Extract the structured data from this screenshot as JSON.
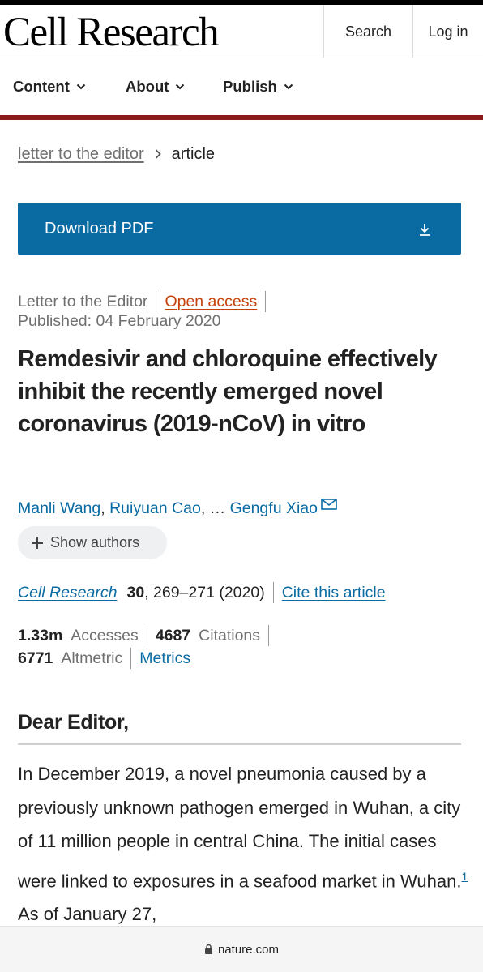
{
  "header": {
    "logo": "Cell Research",
    "search_label": "Search",
    "login_label": "Log in"
  },
  "nav": {
    "items": [
      {
        "label": "Content"
      },
      {
        "label": "About"
      },
      {
        "label": "Publish"
      }
    ]
  },
  "breadcrumb": {
    "parent": "letter to the editor",
    "current": "article"
  },
  "download": {
    "label": "Download PDF"
  },
  "article_meta": {
    "type": "Letter to the Editor",
    "access": "Open access",
    "published": "Published: 04 February 2020"
  },
  "article": {
    "title": "Remdesivir and chloroquine effectively inhibit the recently emerged novel coronavirus (2019-nCoV) in vitro",
    "authors": {
      "first": "Manli Wang",
      "second": "Ruiyuan Cao",
      "sep1": ", ",
      "ellipsis": ", … ",
      "last": "Gengfu Xiao"
    },
    "show_authors_label": "Show authors"
  },
  "citation": {
    "journal": "Cell Research",
    "volume": "30",
    "pages": ", 269–271 (2020)",
    "cite_label": "Cite this article"
  },
  "metrics": {
    "accesses_value": "1.33m",
    "accesses_label": "Accesses",
    "citations_value": "4687",
    "citations_label": "Citations",
    "altmetric_value": "6771",
    "altmetric_label": "Altmetric",
    "metrics_link": "Metrics"
  },
  "body": {
    "salutation": "Dear Editor,",
    "paragraph_before_ref": "In December 2019, a novel pneumonia caused by a previously unknown pathogen emerged in Wuhan, a city of 11 million people in central China. The initial cases were linked to exposures in a seafood market in Wuhan.",
    "ref_number": "1",
    "paragraph_after_ref": " As of January 27,"
  },
  "browser": {
    "domain": "nature.com"
  },
  "colors": {
    "link_blue": "#0a6ba3",
    "brand_red_bar": "#8b1a1a",
    "open_access_orange": "#c4420a"
  },
  "icons": [
    "chevron-down-icon",
    "chevron-right-icon",
    "download-icon",
    "mail-icon",
    "plus-icon",
    "lock-icon"
  ]
}
